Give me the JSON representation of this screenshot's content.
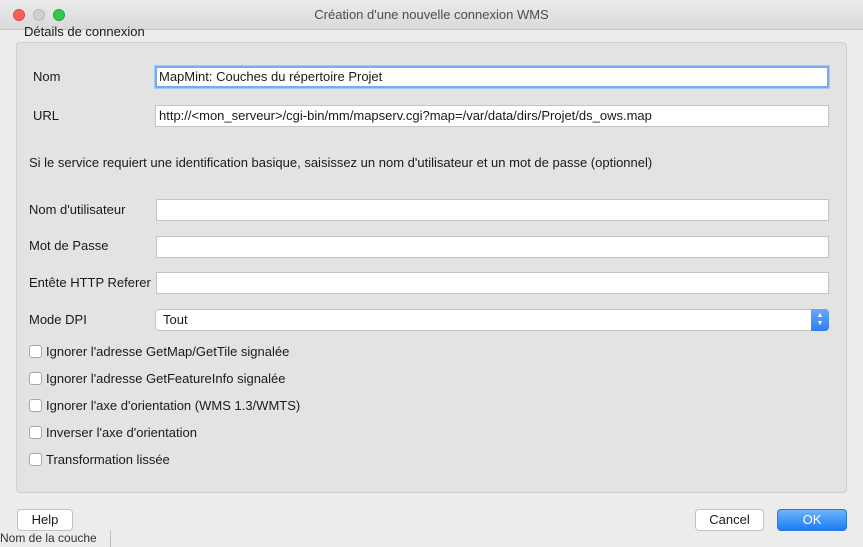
{
  "window": {
    "title": "Création d'une nouvelle connexion WMS"
  },
  "group": {
    "title": "Détails de connexion"
  },
  "fields": {
    "name_label": "Nom",
    "name_value": "MapMint: Couches du répertoire Projet",
    "url_label": "URL",
    "url_value": "http://<mon_serveur>/cgi-bin/mm/mapserv.cgi?map=/var/data/dirs/Projet/ds_ows.map",
    "auth_note": "Si le service requiert une identification basique, saisissez un nom d'utilisateur et un mot de passe (optionnel)",
    "username_label": "Nom d'utilisateur",
    "username_value": "",
    "password_label": "Mot de Passe",
    "password_value": "",
    "referer_label": "Entête HTTP Referer",
    "referer_value": "",
    "dpi_label": "Mode DPI",
    "dpi_selected": "Tout"
  },
  "checkboxes": [
    {
      "label": "Ignorer l'adresse GetMap/GetTile signalée",
      "checked": false
    },
    {
      "label": "Ignorer l'adresse GetFeatureInfo signalée",
      "checked": false
    },
    {
      "label": "Ignorer l'axe d'orientation (WMS 1.3/WMTS)",
      "checked": false
    },
    {
      "label": "Inverser l'axe d'orientation",
      "checked": false
    },
    {
      "label": "Transformation lissée",
      "checked": false
    }
  ],
  "buttons": {
    "help": "Help",
    "cancel": "Cancel",
    "ok": "OK"
  },
  "background": {
    "partial_text": "Nom de la couche"
  },
  "colors": {
    "accent": "#1d7cf2",
    "focus_ring": "#7aaaf0"
  }
}
